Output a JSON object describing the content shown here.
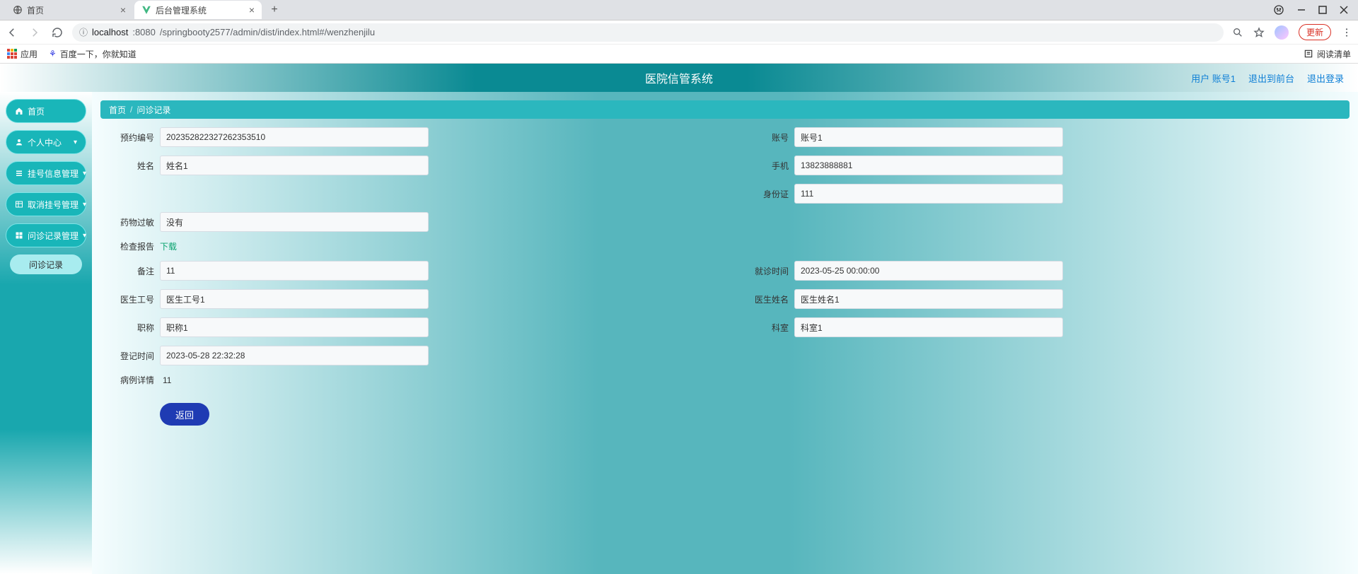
{
  "browser": {
    "tabs": [
      {
        "title": "首页",
        "active": false
      },
      {
        "title": "后台管理系统",
        "active": true
      }
    ],
    "url_host": "localhost",
    "url_port": ":8080",
    "url_path": "/springbooty2577/admin/dist/index.html#/wenzhenjilu",
    "update_label": "更新",
    "bookmarks": {
      "apps": "应用",
      "baidu": "百度一下，你就知道",
      "reading_list": "阅读清单"
    }
  },
  "header": {
    "title": "医院信管系统",
    "user_label": "用户 账号1",
    "to_front": "退出到前台",
    "logout": "退出登录"
  },
  "sidebar": {
    "home": "首页",
    "personal": "个人中心",
    "register_mgmt": "挂号信息管理",
    "cancel_mgmt": "取消挂号管理",
    "record_mgmt": "问诊记录管理",
    "record_sub": "问诊记录"
  },
  "breadcrumb": {
    "home": "首页",
    "current": "问诊记录"
  },
  "form": {
    "labels": {
      "reserve_no": "预约编号",
      "account": "账号",
      "name": "姓名",
      "phone": "手机",
      "idcard": "身份证",
      "allergy": "药物过敏",
      "report": "检查报告",
      "download": "下载",
      "remark": "备注",
      "visit_time": "就诊时间",
      "doc_no": "医生工号",
      "doc_name": "医生姓名",
      "title": "职称",
      "dept": "科室",
      "reg_time": "登记时间",
      "case_detail": "病例详情"
    },
    "values": {
      "reserve_no": "202352822327262353510",
      "account": "账号1",
      "name": "姓名1",
      "phone": "13823888881",
      "idcard": "111",
      "allergy": "没有",
      "remark": "11",
      "visit_time": "2023-05-25 00:00:00",
      "doc_no": "医生工号1",
      "doc_name": "医生姓名1",
      "title": "职称1",
      "dept": "科室1",
      "reg_time": "2023-05-28 22:32:28",
      "case_detail": "11"
    },
    "return_btn": "返回"
  }
}
